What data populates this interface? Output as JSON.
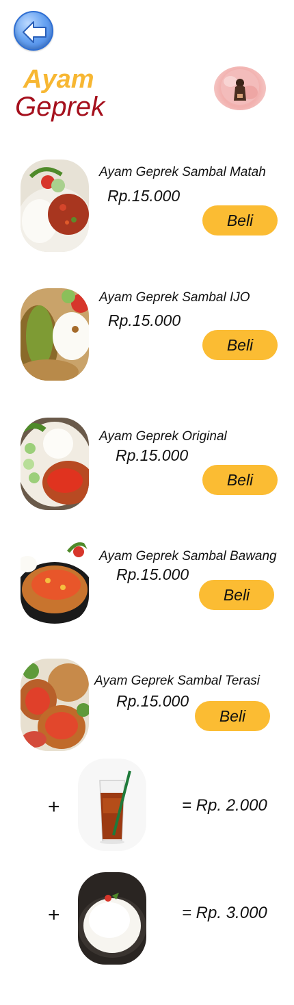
{
  "header": {
    "title_line1": "Ayam",
    "title_line2": "Geprek"
  },
  "icons": {
    "back": "arrow-left-icon",
    "avatar": "profile-avatar"
  },
  "colors": {
    "accent": "#fbbc33",
    "title_orange": "#f7b733",
    "title_red": "#a5101d",
    "back_blue": "#3a7ae0"
  },
  "menu": [
    {
      "name": "Ayam Geprek Sambal Matah",
      "price": "Rp.15.000",
      "button": "Beli"
    },
    {
      "name": "Ayam Geprek Sambal IJO",
      "price": "Rp.15.000",
      "button": "Beli"
    },
    {
      "name": "Ayam Geprek Original",
      "price": "Rp.15.000",
      "button": "Beli"
    },
    {
      "name": "Ayam Geprek Sambal Bawang",
      "price": "Rp.15.000",
      "button": "Beli"
    },
    {
      "name": "Ayam Geprek Sambal Terasi",
      "price": "Rp.15.000",
      "button": "Beli"
    }
  ],
  "addons": [
    {
      "symbol": "+",
      "price": "= Rp. 2.000"
    },
    {
      "symbol": "+",
      "price": "= Rp. 3.000"
    }
  ]
}
